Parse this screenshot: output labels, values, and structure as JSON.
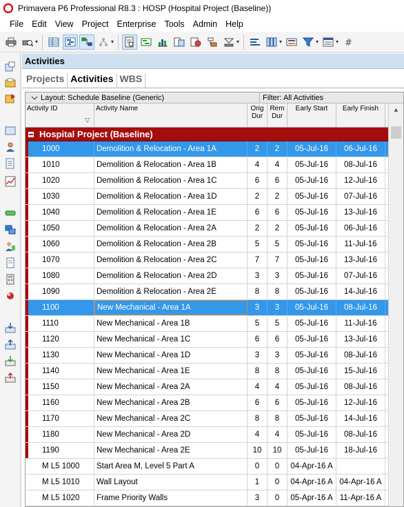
{
  "window": {
    "title": "Primavera P6 Professional R8.3 : HOSP (Hospital Project (Baseline))"
  },
  "menu": [
    "File",
    "Edit",
    "View",
    "Project",
    "Enterprise",
    "Tools",
    "Admin",
    "Help"
  ],
  "toolbar": {
    "icons": [
      "print-icon",
      "print-preview-icon",
      "table-icon",
      "gantt-icon",
      "network-icon",
      "reflect-icon",
      "layout-icon",
      "schedule-icon",
      "level-icon",
      "baseline-icon",
      "progress-icon",
      "summarize-icon",
      "assign-icon",
      "bars-icon",
      "columns-icon",
      "filter-icon",
      "group-icon",
      "hash-icon"
    ]
  },
  "panel": {
    "title": "Activities",
    "tabs": [
      "Projects",
      "Activities",
      "WBS"
    ],
    "active_tab": "Activities"
  },
  "grid": {
    "layout_label": "Layout: Schedule Baseline (Generic)",
    "filter_label": "Filter: All Activities",
    "headers": {
      "id": "Activity ID",
      "name": "Activity Name",
      "orig_dur": "Orig Dur",
      "rem_dur": "Rem Dur",
      "early_start": "Early Start",
      "early_finish": "Early Finish"
    },
    "group_label": "Hospital Project (Baseline)",
    "rows": [
      {
        "id": "1000",
        "name": "Demolition & Relocation - Area 1A",
        "orig": "2",
        "rem": "2",
        "es": "05-Jul-16",
        "ef": "06-Jul-16",
        "selected": true
      },
      {
        "id": "1010",
        "name": "Demolition & Relocation - Area 1B",
        "orig": "4",
        "rem": "4",
        "es": "05-Jul-16",
        "ef": "08-Jul-16"
      },
      {
        "id": "1020",
        "name": "Demolition & Relocation - Area 1C",
        "orig": "6",
        "rem": "6",
        "es": "05-Jul-16",
        "ef": "12-Jul-16"
      },
      {
        "id": "1030",
        "name": "Demolition & Relocation - Area 1D",
        "orig": "2",
        "rem": "2",
        "es": "05-Jul-16",
        "ef": "07-Jul-16"
      },
      {
        "id": "1040",
        "name": "Demolition & Relocation - Area 1E",
        "orig": "6",
        "rem": "6",
        "es": "05-Jul-16",
        "ef": "13-Jul-16"
      },
      {
        "id": "1050",
        "name": "Demolition & Relocation - Area 2A",
        "orig": "2",
        "rem": "2",
        "es": "05-Jul-16",
        "ef": "06-Jul-16"
      },
      {
        "id": "1060",
        "name": "Demolition & Relocation - Area 2B",
        "orig": "5",
        "rem": "5",
        "es": "05-Jul-16",
        "ef": "11-Jul-16"
      },
      {
        "id": "1070",
        "name": "Demolition & Relocation - Area 2C",
        "orig": "7",
        "rem": "7",
        "es": "05-Jul-16",
        "ef": "13-Jul-16"
      },
      {
        "id": "1080",
        "name": "Demolition & Relocation - Area 2D",
        "orig": "3",
        "rem": "3",
        "es": "05-Jul-16",
        "ef": "07-Jul-16"
      },
      {
        "id": "1090",
        "name": "Demolition & Relocation - Area 2E",
        "orig": "8",
        "rem": "8",
        "es": "05-Jul-16",
        "ef": "14-Jul-16"
      },
      {
        "id": "1100",
        "name": "New Mechanical - Area 1A",
        "orig": "3",
        "rem": "3",
        "es": "05-Jul-16",
        "ef": "08-Jul-16",
        "selected": true,
        "focus": true
      },
      {
        "id": "1110",
        "name": "New Mechanical - Area 1B",
        "orig": "5",
        "rem": "5",
        "es": "05-Jul-16",
        "ef": "11-Jul-16"
      },
      {
        "id": "1120",
        "name": "New Mechanical - Area 1C",
        "orig": "6",
        "rem": "6",
        "es": "05-Jul-16",
        "ef": "13-Jul-16"
      },
      {
        "id": "1130",
        "name": "New Mechanical - Area 1D",
        "orig": "3",
        "rem": "3",
        "es": "05-Jul-16",
        "ef": "08-Jul-16"
      },
      {
        "id": "1140",
        "name": "New Mechanical - Area 1E",
        "orig": "8",
        "rem": "8",
        "es": "05-Jul-16",
        "ef": "15-Jul-16"
      },
      {
        "id": "1150",
        "name": "New Mechanical - Area 2A",
        "orig": "4",
        "rem": "4",
        "es": "05-Jul-16",
        "ef": "08-Jul-16"
      },
      {
        "id": "1160",
        "name": "New Mechanical - Area 2B",
        "orig": "6",
        "rem": "6",
        "es": "05-Jul-16",
        "ef": "12-Jul-16"
      },
      {
        "id": "1170",
        "name": "New Mechanical - Area 2C",
        "orig": "8",
        "rem": "8",
        "es": "05-Jul-16",
        "ef": "14-Jul-16"
      },
      {
        "id": "1180",
        "name": "New Mechanical - Area 2D",
        "orig": "4",
        "rem": "4",
        "es": "05-Jul-16",
        "ef": "08-Jul-16"
      },
      {
        "id": "1190",
        "name": "New Mechanical - Area 2E",
        "orig": "10",
        "rem": "10",
        "es": "05-Jul-16",
        "ef": "18-Jul-16"
      },
      {
        "id": "M L5 1000",
        "name": "Start Area M, Level 5 Part A",
        "orig": "0",
        "rem": "0",
        "es": "04-Apr-16 A",
        "ef": "",
        "nobar": true
      },
      {
        "id": "M L5 1010",
        "name": "Wall Layout",
        "orig": "1",
        "rem": "0",
        "es": "04-Apr-16 A",
        "ef": "04-Apr-16 A",
        "nobar": true
      },
      {
        "id": "M L5 1020",
        "name": "Frame Priority Walls",
        "orig": "3",
        "rem": "0",
        "es": "05-Apr-16 A",
        "ef": "11-Apr-16 A",
        "nobar": true
      }
    ]
  },
  "sidebar": {
    "icons": [
      "enterprise-projects-icon",
      "open-project-icon",
      "copy-project-icon",
      "portfolios-icon",
      "resources-icon",
      "reports-icon",
      "tracking-icon",
      "wbs-icon",
      "activities-icon",
      "assignments-icon",
      "work-products-icon",
      "expenses-icon",
      "risks-icon",
      "import-icon",
      "export-icon",
      "check-in-icon",
      "check-out-icon"
    ]
  }
}
